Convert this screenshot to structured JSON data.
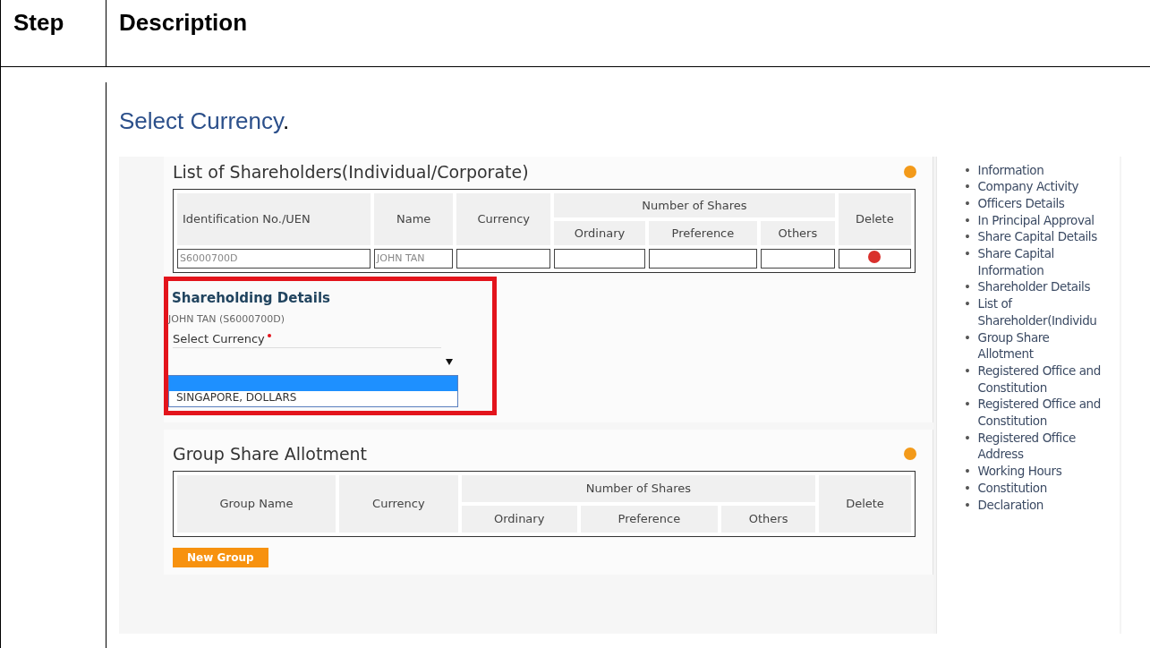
{
  "table": {
    "columns": [
      "Step",
      "Description"
    ],
    "step": {
      "instruction": "Select Currency",
      "instruction_end": ".",
      "screenshot": {
        "shareholders": {
          "title": "List of Shareholders(Individual/Corporate)",
          "columns": {
            "id": "Identification No./UEN",
            "name": "Name",
            "currency": "Currency",
            "shares": "Number of Shares",
            "ordinary": "Ordinary",
            "preference": "Preference",
            "others": "Others",
            "delete": "Delete"
          },
          "row": {
            "id": "S6000700D",
            "name": "JOHN TAN"
          }
        },
        "shareholding": {
          "highlighted": true,
          "title": "Shareholding Details",
          "person": "JOHN TAN (S6000700D)",
          "label": "Select Currency",
          "required": true,
          "dropdown": {
            "blank_option_selected": true,
            "options": [
              {
                "label": "SINGAPORE, DOLLARS",
                "selected": false
              }
            ]
          }
        },
        "group": {
          "title": "Group Share Allotment",
          "columns": {
            "group": "Group Name",
            "currency": "Currency",
            "shares": "Number of Shares",
            "ordinary": "Ordinary",
            "preference": "Preference",
            "others": "Others",
            "delete": "Delete"
          },
          "button": "New Group"
        },
        "sidebar": {
          "bullet": "•",
          "items": [
            "Information",
            "Company Activity",
            "Officers Details",
            "In Principal Approval",
            "Share Capital Details",
            "Share Capital Information",
            "Shareholder Details",
            "List of Shareholder(Individu",
            "Group Share Allotment",
            "Registered Office and Constitution",
            "Registered Office and Constitution",
            "Registered Office Address",
            "Working Hours",
            "Constitution",
            "Declaration"
          ]
        }
      }
    }
  }
}
